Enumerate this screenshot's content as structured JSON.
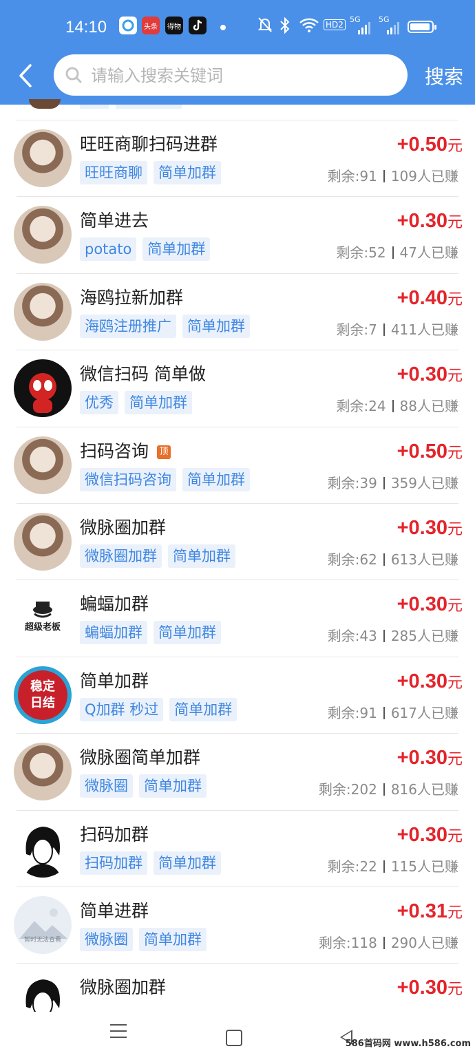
{
  "status_bar": {
    "time": "14:10",
    "apps": [
      "toutiao-icon",
      "app2-icon",
      "app3-icon",
      "tiktok-icon"
    ],
    "app_labels": [
      "头条",
      "得物"
    ],
    "network": [
      "HD2",
      "5G",
      "5G"
    ]
  },
  "search": {
    "placeholder": "请输入搜索关键词",
    "button_label": "搜索"
  },
  "colors": {
    "header": "#4a90e8",
    "price": "#e4242b",
    "tag_text": "#3f87e2",
    "tag_bg": "#eaf1fb",
    "top_badge": "#e8702a"
  },
  "tasks": [
    {
      "title": "旺旺商聊扫码进群",
      "tags": [
        "旺旺商聊",
        "简单加群"
      ],
      "price": "+0.50",
      "unit": "元",
      "remaining": "剩余:91",
      "earned": "109人已赚",
      "avatar": "avatar-photo"
    },
    {
      "title": "简单进去",
      "tags": [
        "potato",
        "简单加群"
      ],
      "price": "+0.30",
      "unit": "元",
      "remaining": "剩余:52",
      "earned": "47人已赚",
      "avatar": "avatar-photo"
    },
    {
      "title": "海鸥拉新加群",
      "tags": [
        "海鸥注册推广",
        "简单加群"
      ],
      "price": "+0.40",
      "unit": "元",
      "remaining": "剩余:7",
      "earned": "411人已赚",
      "avatar": "avatar-photo"
    },
    {
      "title": "微信扫码 简单做",
      "tags": [
        "优秀",
        "简单加群"
      ],
      "price": "+0.30",
      "unit": "元",
      "remaining": "剩余:24",
      "earned": "88人已赚",
      "avatar": "avatar-spiderman"
    },
    {
      "title": "扫码咨询",
      "top_badge": "顶",
      "tags": [
        "微信扫码咨询",
        "简单加群"
      ],
      "price": "+0.50",
      "unit": "元",
      "remaining": "剩余:39",
      "earned": "359人已赚",
      "avatar": "avatar-photo"
    },
    {
      "title": "微脉圈加群",
      "tags": [
        "微脉圈加群",
        "简单加群"
      ],
      "price": "+0.30",
      "unit": "元",
      "remaining": "剩余:62",
      "earned": "613人已赚",
      "avatar": "avatar-photo"
    },
    {
      "title": "蝙蝠加群",
      "tags": [
        "蝙蝠加群",
        "简单加群"
      ],
      "price": "+0.30",
      "unit": "元",
      "remaining": "剩余:43",
      "earned": "285人已赚",
      "avatar": "avatar-logo",
      "avatar_text": "超级老板"
    },
    {
      "title": "简单加群",
      "tags": [
        "Q加群 秒过",
        "简单加群"
      ],
      "price": "+0.30",
      "unit": "元",
      "remaining": "剩余:91",
      "earned": "617人已赚",
      "avatar": "avatar-stamp",
      "avatar_text": "稳定日结"
    },
    {
      "title": "微脉圈简单加群",
      "tags": [
        "微脉圈",
        "简单加群"
      ],
      "price": "+0.30",
      "unit": "元",
      "remaining": "剩余:202",
      "earned": "816人已赚",
      "avatar": "avatar-photo"
    },
    {
      "title": "扫码加群",
      "tags": [
        "扫码加群",
        "简单加群"
      ],
      "price": "+0.30",
      "unit": "元",
      "remaining": "剩余:22",
      "earned": "115人已赚",
      "avatar": "avatar-anime"
    },
    {
      "title": "简单进群",
      "tags": [
        "微脉圈",
        "简单加群"
      ],
      "price": "+0.31",
      "unit": "元",
      "remaining": "剩余:118",
      "earned": "290人已赚",
      "avatar": "avatar-placeholder",
      "avatar_text": "暂时无法查看"
    },
    {
      "title": "微脉圈加群",
      "tags": [],
      "price": "+0.30",
      "unit": "元",
      "remaining": "",
      "earned": "",
      "avatar": "avatar-anime"
    }
  ],
  "watermark": "586首码网 www.h586.com"
}
